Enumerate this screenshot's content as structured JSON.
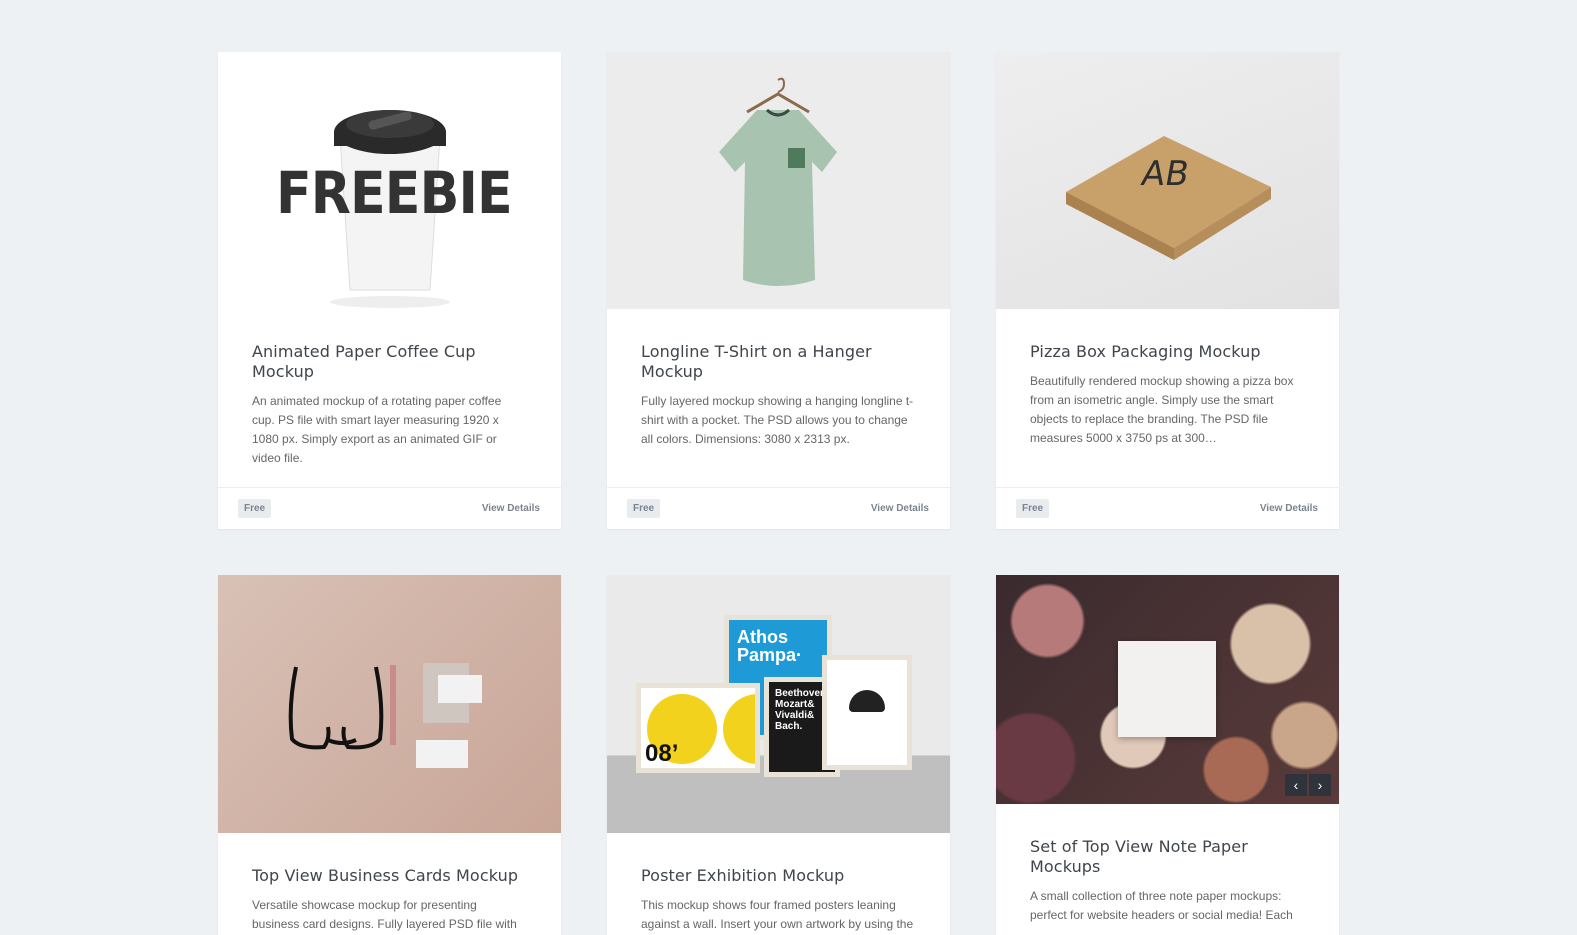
{
  "cards": [
    {
      "title": "Animated Paper Coffee Cup Mockup",
      "desc": "An animated mockup of a rotating paper coffee cup. PS file with smart layer measuring 1920 x 1080 px. Simply export as an animated GIF or video file.",
      "tag": "Free",
      "link": "View Details",
      "thumb_text": "FREEBIE"
    },
    {
      "title": "Longline T-Shirt on a Hanger Mockup",
      "desc": "Fully layered mockup showing a hanging longline t-shirt with a pocket. The PSD allows you to change all colors. Dimensions: 3080 x 2313 px.",
      "tag": "Free",
      "link": "View Details"
    },
    {
      "title": "Pizza Box Packaging Mockup",
      "desc": "Beautifully rendered mockup showing a pizza box from an isometric angle. Simply use the smart objects to replace the branding. The PSD file measures 5000 x 3750 ps at 300…",
      "tag": "Free",
      "link": "View Details",
      "thumb_text": "AB"
    },
    {
      "title": "Top View Business Cards Mockup",
      "desc": "Versatile showcase mockup for presenting business card designs. Fully layered PSD file with smart"
    },
    {
      "title": "Poster Exhibition Mockup",
      "desc": "This mockup shows four framed posters leaning against a wall. Insert your own artwork by using the",
      "poster_text_1": "Athos Pampa·",
      "poster_text_2": "Beethoven& Mozart& Vivaldi& Bach.",
      "poster_text_3": "08’"
    },
    {
      "title": "Set of Top View Note Paper Mockups",
      "desc": "A small collection of three note paper mockups: perfect for website headers or social media! Each",
      "prev": "‹",
      "next": "›"
    }
  ]
}
